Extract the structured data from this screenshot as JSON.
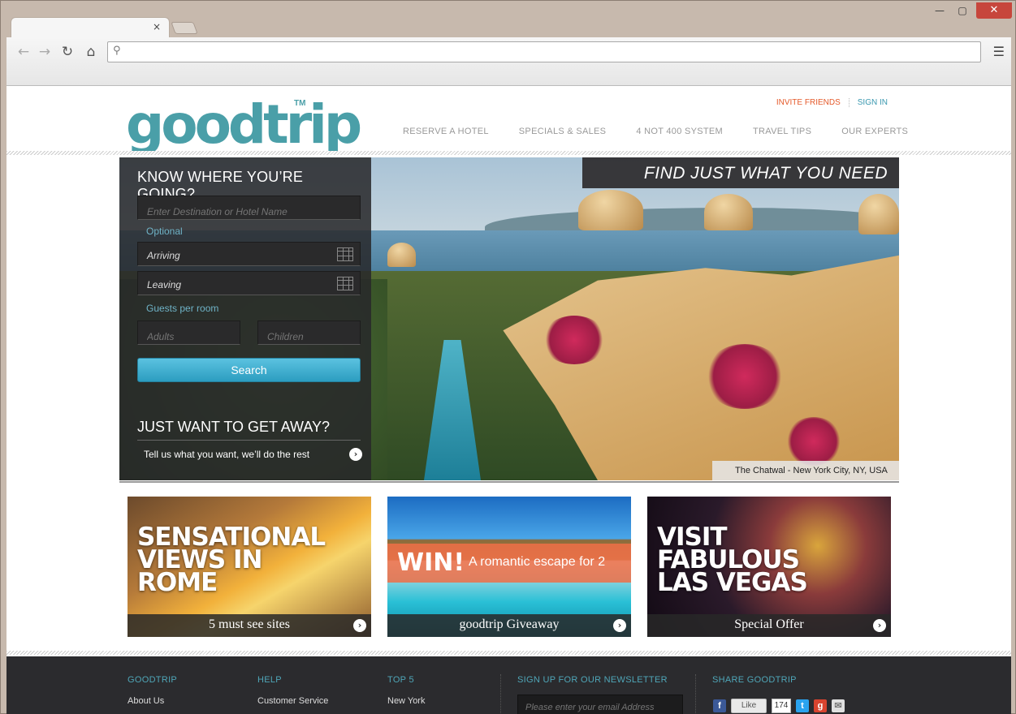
{
  "browser": {
    "minimize": "—",
    "maximize": "▢",
    "close": "✕",
    "tab_close": "×",
    "address_placeholder": ""
  },
  "site": {
    "logo": "goodtrip",
    "logo_tm": "TM",
    "top_links": {
      "invite": "INVITE FRIENDS",
      "signin": "SIGN IN"
    },
    "nav": [
      "RESERVE A HOTEL",
      "SPECIALS & SALES",
      "4 NOT 400 SYSTEM",
      "TRAVEL TIPS",
      "OUR EXPERTS"
    ]
  },
  "search": {
    "title": "KNOW WHERE YOU’RE GOING?",
    "destination_placeholder": "Enter Destination or Hotel Name",
    "optional_label": "Optional",
    "arriving_placeholder": "Arriving",
    "leaving_placeholder": "Leaving",
    "guests_label": "Guests per room",
    "adults_placeholder": "Adults",
    "children_placeholder": "Children",
    "search_label": "Search",
    "away_title": "JUST WANT TO GET AWAY?",
    "away_text": "Tell us what you want, we’ll do the rest"
  },
  "hero": {
    "banner": "FIND JUST WHAT YOU NEED",
    "caption": "The Chatwal - New York City, NY, USA"
  },
  "promos": [
    {
      "headline": "SENSATIONAL VIEWS IN ROME",
      "caption": "5 must see sites"
    },
    {
      "win": "WIN!",
      "tagline": "A romantic escape for 2",
      "caption": "goodtrip Giveaway"
    },
    {
      "headline": "VISIT FABULOUS LAS VEGAS",
      "caption": "Special Offer"
    }
  ],
  "footer": {
    "goodtrip": {
      "heading": "GOODTRIP",
      "link": "About Us"
    },
    "help": {
      "heading": "HELP",
      "link": "Customer Service"
    },
    "top5": {
      "heading": "TOP 5",
      "link": "New York"
    },
    "newsletter": {
      "heading": "SIGN UP FOR OUR NEWSLETTER",
      "placeholder": "Please enter your email Address"
    },
    "share": {
      "heading": "SHARE GOODTRIP",
      "like": "Like",
      "count": "174"
    }
  },
  "colors": {
    "brand": "#4a9fa8",
    "accent_orange": "#e55a2b",
    "search_blue": "#2c9dc0",
    "footer_bg": "#2b2b2e"
  }
}
